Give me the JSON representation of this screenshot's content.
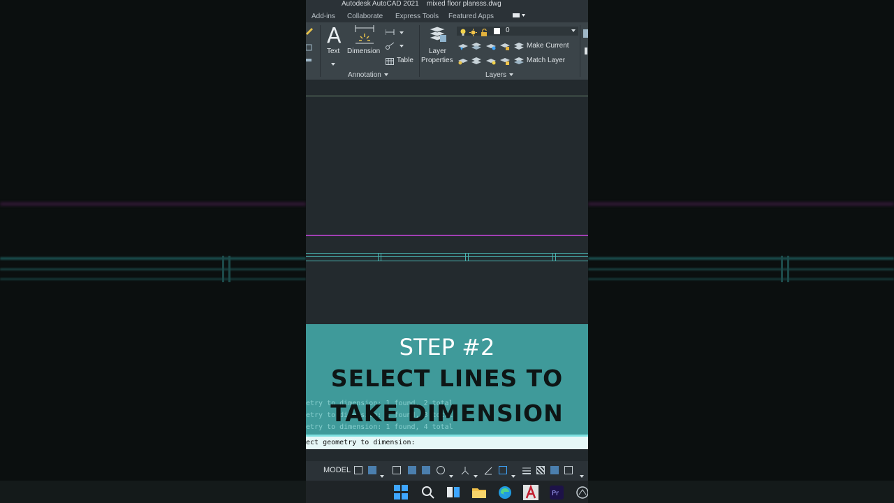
{
  "window": {
    "app_title": "Autodesk AutoCAD 2021",
    "file_name": "mixed floor plansss.dwg"
  },
  "ribbon_tabs": [
    "Add-ins",
    "Collaborate",
    "Express Tools",
    "Featured Apps"
  ],
  "annotation_panel": {
    "text_label": "Text",
    "dimension_label": "Dimension",
    "table_label": "Table",
    "title": "Annotation"
  },
  "layers_panel": {
    "layer_properties_line1": "Layer",
    "layer_properties_line2": "Properties",
    "current_layer": "0",
    "make_current_label": "Make Current",
    "match_layer_label": "Match Layer",
    "title": "Layers"
  },
  "overlay": {
    "step": "STEP #2",
    "line1": "SELECT LINES TO",
    "line2": "TAKE DIMENSION"
  },
  "command_history": [
    "etry to dimension: 1 found, 2 total",
    "etry to dimension: 1 found, 3 total",
    "etry to dimension: 1 found, 4 total"
  ],
  "command_prompt": "ect geometry to dimension:",
  "statusbar": {
    "model_label": "MODEL"
  },
  "colors": {
    "overlay": "#3f9a9a",
    "magenta_line": "#a13fb3",
    "teal_line": "#49b3b0"
  }
}
